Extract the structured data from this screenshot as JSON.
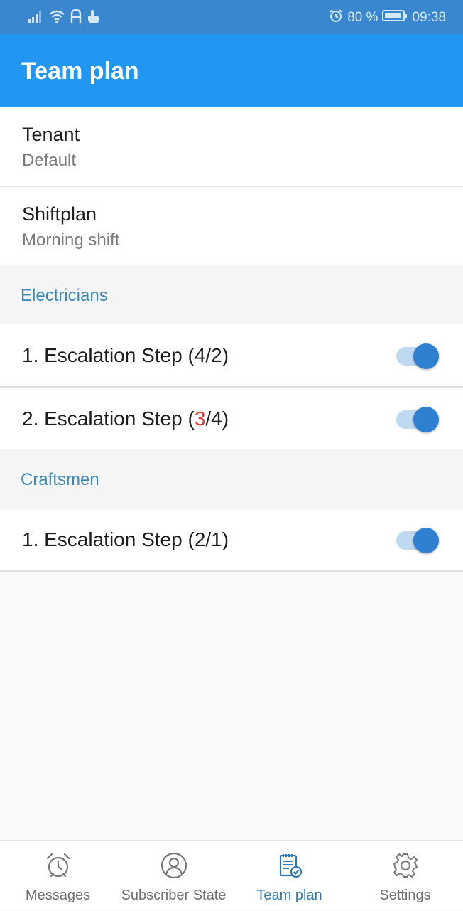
{
  "status_bar": {
    "battery_text": "80 %",
    "time": "09:38"
  },
  "app_bar": {
    "title": "Team plan"
  },
  "settings": [
    {
      "title": "Tenant",
      "value": "Default"
    },
    {
      "title": "Shiftplan",
      "value": "Morning shift"
    }
  ],
  "sections": [
    {
      "header": "Electricians",
      "steps": [
        {
          "prefix": "1. Escalation Step (",
          "current": "4",
          "sep": "/",
          "total": "2",
          "suffix": ")",
          "current_alert": false,
          "enabled": true
        },
        {
          "prefix": "2. Escalation Step (",
          "current": "3",
          "sep": "/",
          "total": "4",
          "suffix": ")",
          "current_alert": true,
          "enabled": true
        }
      ]
    },
    {
      "header": "Craftsmen",
      "steps": [
        {
          "prefix": "1. Escalation Step (",
          "current": "2",
          "sep": "/",
          "total": "1",
          "suffix": ")",
          "current_alert": false,
          "enabled": true
        }
      ]
    }
  ],
  "bottom_nav": [
    {
      "label": "Messages",
      "icon": "alarm-clock-icon",
      "active": false
    },
    {
      "label": "Subscriber State",
      "icon": "person-circle-icon",
      "active": false
    },
    {
      "label": "Team plan",
      "icon": "clipboard-check-icon",
      "active": true
    },
    {
      "label": "Settings",
      "icon": "gear-icon",
      "active": false
    }
  ],
  "colors": {
    "status_bar": "#3a86cf",
    "app_bar": "#2196f3",
    "section_header_text": "#3a87b8",
    "toggle_on": "#2f80d0",
    "alert": "#e53935",
    "nav_active": "#2d79b5"
  }
}
